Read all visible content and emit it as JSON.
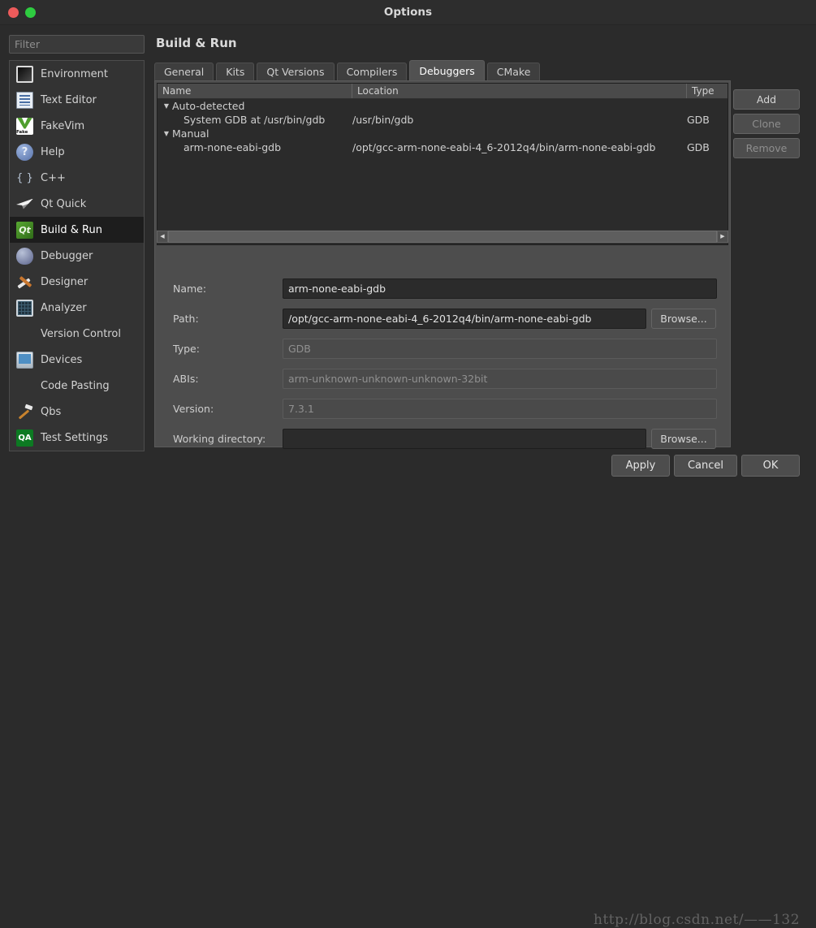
{
  "window": {
    "title": "Options",
    "controls": {
      "close": "close-button",
      "maximize": "maximize-button"
    }
  },
  "filter": {
    "placeholder": "Filter",
    "value": ""
  },
  "sidebar": {
    "items": [
      {
        "label": "Environment",
        "icon": "environment-icon",
        "selected": false
      },
      {
        "label": "Text Editor",
        "icon": "text-editor-icon",
        "selected": false
      },
      {
        "label": "FakeVim",
        "icon": "fakevim-icon",
        "selected": false
      },
      {
        "label": "Help",
        "icon": "help-icon",
        "selected": false
      },
      {
        "label": "C++",
        "icon": "cpp-icon",
        "selected": false
      },
      {
        "label": "Qt Quick",
        "icon": "qt-quick-icon",
        "selected": false
      },
      {
        "label": "Build & Run",
        "icon": "build-run-icon",
        "selected": true
      },
      {
        "label": "Debugger",
        "icon": "debugger-icon",
        "selected": false
      },
      {
        "label": "Designer",
        "icon": "designer-icon",
        "selected": false
      },
      {
        "label": "Analyzer",
        "icon": "analyzer-icon",
        "selected": false
      },
      {
        "label": "Version Control",
        "icon": "version-control-icon",
        "selected": false
      },
      {
        "label": "Devices",
        "icon": "devices-icon",
        "selected": false
      },
      {
        "label": "Code Pasting",
        "icon": "code-pasting-icon",
        "selected": false
      },
      {
        "label": "Qbs",
        "icon": "qbs-icon",
        "selected": false
      },
      {
        "label": "Test Settings",
        "icon": "test-settings-icon",
        "selected": false
      }
    ]
  },
  "page": {
    "title": "Build & Run"
  },
  "tabs": [
    {
      "label": "General",
      "selected": false
    },
    {
      "label": "Kits",
      "selected": false
    },
    {
      "label": "Qt Versions",
      "selected": false
    },
    {
      "label": "Compilers",
      "selected": false
    },
    {
      "label": "Debuggers",
      "selected": true
    },
    {
      "label": "CMake",
      "selected": false
    }
  ],
  "tree": {
    "columns": [
      "Name",
      "Location",
      "Type"
    ],
    "rows": [
      {
        "indent": 0,
        "twisty": "▼",
        "name": "Auto-detected",
        "location": "",
        "type": ""
      },
      {
        "indent": 1,
        "twisty": "",
        "name": "System GDB at /usr/bin/gdb",
        "location": "/usr/bin/gdb",
        "type": "GDB"
      },
      {
        "indent": 0,
        "twisty": "▼",
        "name": "Manual",
        "location": "",
        "type": ""
      },
      {
        "indent": 1,
        "twisty": "",
        "name": "arm-none-eabi-gdb",
        "location": "/opt/gcc-arm-none-eabi-4_6-2012q4/bin/arm-none-eabi-gdb",
        "type": "GDB"
      }
    ],
    "scroll_left_arrow": "◀",
    "scroll_right_arrow": "▶"
  },
  "side_buttons": [
    {
      "label": "Add",
      "disabled": false
    },
    {
      "label": "Clone",
      "disabled": true
    },
    {
      "label": "Remove",
      "disabled": true
    }
  ],
  "form": {
    "name": {
      "label": "Name:",
      "value": "arm-none-eabi-gdb",
      "readonly": false
    },
    "path": {
      "label": "Path:",
      "value": "/opt/gcc-arm-none-eabi-4_6-2012q4/bin/arm-none-eabi-gdb",
      "readonly": false,
      "browse": "Browse..."
    },
    "type": {
      "label": "Type:",
      "value": "GDB",
      "readonly": true
    },
    "abis": {
      "label": "ABIs:",
      "value": "arm-unknown-unknown-unknown-32bit",
      "readonly": true
    },
    "version": {
      "label": "Version:",
      "value": "7.3.1",
      "readonly": true
    },
    "workdir": {
      "label": "Working directory:",
      "value": "",
      "readonly": false,
      "browse": "Browse..."
    }
  },
  "bottom_buttons": {
    "apply": "Apply",
    "cancel": "Cancel",
    "ok": "OK"
  },
  "watermark": {
    "text": "http://blog.csdn.net/——132"
  },
  "colors": {
    "window_bg": "#2b2b2b",
    "panel_bg": "#4d4d4d",
    "sidebar_bg": "#333333",
    "selected_item_bg": "#1d1d1d",
    "field_bg": "#2b2b2b",
    "readonly_field_bg": "#4a4a4a",
    "text": "#d3d3d3",
    "accent_close": "#ed5b5b",
    "accent_max": "#2ecc40"
  }
}
